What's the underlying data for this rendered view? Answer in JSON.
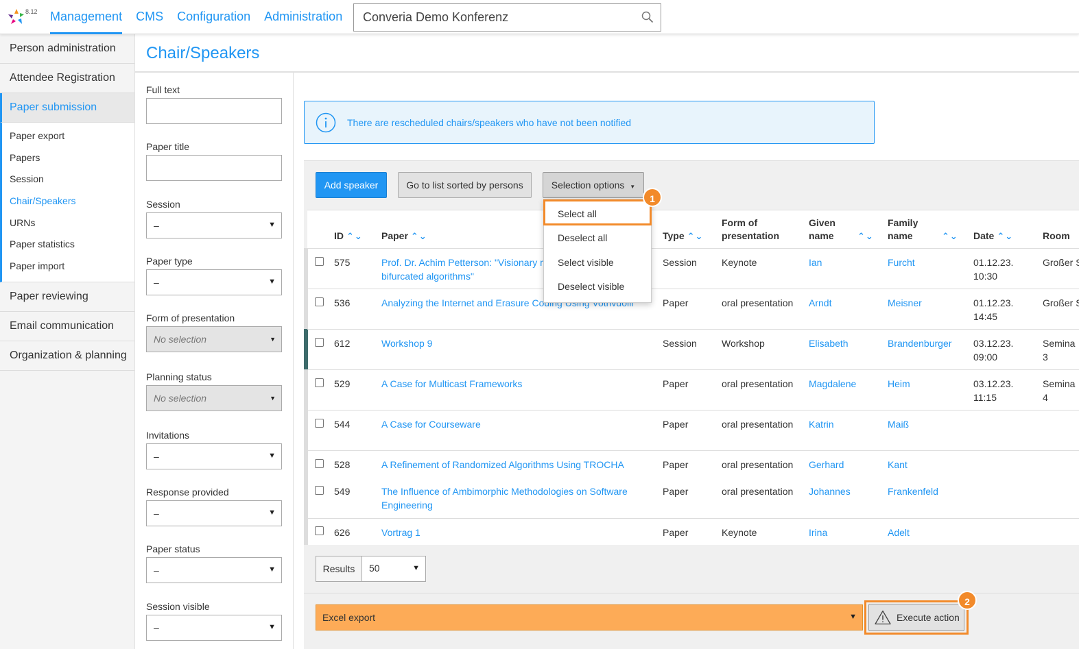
{
  "app": {
    "version": "8.12"
  },
  "nav": {
    "items": [
      "Management",
      "CMS",
      "Configuration",
      "Administration"
    ],
    "active": "Management"
  },
  "search": {
    "value": "Converia Demo Konferenz"
  },
  "sidebar": {
    "main_top": [
      "Person administration",
      "Attendee Registration"
    ],
    "active_section": "Paper submission",
    "sub_items": [
      "Paper export",
      "Papers",
      "Session",
      "Chair/Speakers",
      "URNs",
      "Paper statistics",
      "Paper import"
    ],
    "active_sub": "Chair/Speakers",
    "main_bottom": [
      "Paper reviewing",
      "Email communication",
      "Organization & planning"
    ]
  },
  "page": {
    "title": "Chair/Speakers"
  },
  "filters": {
    "full_text": {
      "label": "Full text",
      "value": ""
    },
    "paper_title": {
      "label": "Paper title",
      "value": ""
    },
    "session": {
      "label": "Session",
      "value": "–"
    },
    "paper_type": {
      "label": "Paper type",
      "value": "–"
    },
    "form_of_presentation": {
      "label": "Form of presentation",
      "value": "No selection"
    },
    "planning_status": {
      "label": "Planning status",
      "value": "No selection"
    },
    "invitations": {
      "label": "Invitations",
      "value": "–"
    },
    "response_provided": {
      "label": "Response provided",
      "value": "–"
    },
    "paper_status": {
      "label": "Paper status",
      "value": "–"
    },
    "session_visible": {
      "label": "Session visible",
      "value": "–"
    }
  },
  "info": {
    "message": "There are rescheduled chairs/speakers who have not been notified"
  },
  "toolbar": {
    "add_speaker": "Add speaker",
    "go_to_list": "Go to list sorted by persons",
    "selection_options": "Selection options"
  },
  "selection_menu": {
    "items": [
      "Select all",
      "Deselect all",
      "Select visible",
      "Deselect visible"
    ]
  },
  "table": {
    "headers": {
      "id": "ID",
      "paper": "Paper",
      "type": "Type",
      "form": [
        "Form of",
        "presentation"
      ],
      "given": [
        "Given",
        "name"
      ],
      "family": [
        "Family",
        "name"
      ],
      "date": "Date",
      "room": "Room"
    },
    "rows": [
      {
        "id": "575",
        "paper": [
          "Prof. Dr. Achim Petterson: \"Visionary m",
          "bifurcated algorithms\""
        ],
        "type": "Session",
        "form": "Keynote",
        "given": "Ian",
        "family": "Furcht",
        "date": [
          "01.12.23.",
          "10:30"
        ],
        "room": [
          "Großer S"
        ]
      },
      {
        "id": "536",
        "paper": [
          "Analyzing the Internet and Erasure Coding Using Vothvdolli"
        ],
        "type": "Paper",
        "form": "oral presentation",
        "given": "Arndt",
        "family": "Meisner",
        "date": [
          "01.12.23.",
          "14:45"
        ],
        "room": [
          "Großer S"
        ]
      },
      {
        "id": "612",
        "paper": [
          "Workshop 9"
        ],
        "type": "Session",
        "form": "Workshop",
        "given": "Elisabeth",
        "family": "Brandenburger",
        "date": [
          "03.12.23.",
          "09:00"
        ],
        "room": [
          "Semina",
          "3"
        ]
      },
      {
        "id": "529",
        "paper": [
          "A Case for Multicast Frameworks"
        ],
        "type": "Paper",
        "form": "oral presentation",
        "given": "Magdalene",
        "family": "Heim",
        "date": [
          "03.12.23.",
          "11:15"
        ],
        "room": [
          "Semina",
          "4"
        ]
      },
      {
        "id": "544",
        "paper": [
          "A Case for Courseware"
        ],
        "type": "Paper",
        "form": "oral presentation",
        "given": "Katrin",
        "family": "Maiß",
        "date": [
          "",
          ""
        ],
        "room": [
          ""
        ]
      },
      {
        "id": "528",
        "paper": [
          "A Refinement of Randomized Algorithms Using TROCHA"
        ],
        "type": "Paper",
        "form": "oral presentation",
        "given": "Gerhard",
        "family": "Kant",
        "date": [
          "",
          ""
        ],
        "room": [
          ""
        ]
      },
      {
        "id": "549",
        "paper": [
          "The Influence of Ambimorphic Methodologies on Software",
          "Engineering"
        ],
        "type": "Paper",
        "form": "oral presentation",
        "given": "Johannes",
        "family": "Frankenfeld",
        "date": [
          "",
          ""
        ],
        "room": [
          ""
        ]
      },
      {
        "id": "626",
        "paper": [
          "Vortrag 1"
        ],
        "type": "Paper",
        "form": "Keynote",
        "given": "Irina",
        "family": "Adelt",
        "date": [
          "",
          ""
        ],
        "room": [
          ""
        ]
      }
    ]
  },
  "results": {
    "label": "Results",
    "value": "50"
  },
  "action": {
    "selected": "Excel export",
    "execute": "Execute action"
  },
  "badges": {
    "one": "1",
    "two": "2"
  },
  "colors": {
    "accent": "#2196f3",
    "highlight": "#f28a2a",
    "action_bg": "#fdab57"
  }
}
